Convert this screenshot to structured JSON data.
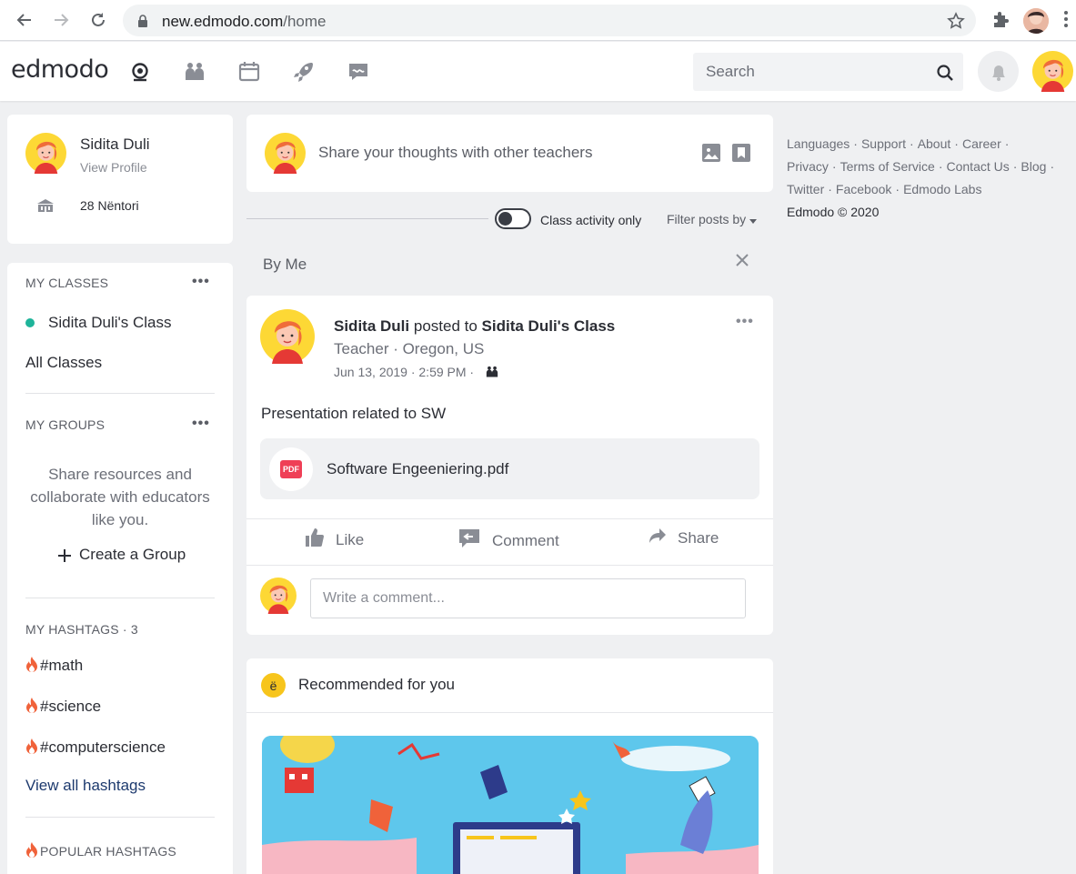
{
  "browser": {
    "url_domain": "new.edmodo.com",
    "url_path": "/home"
  },
  "header": {
    "logo": "edmodo",
    "search_placeholder": "Search"
  },
  "profile": {
    "name": "Sidita Duli",
    "view_profile": "View Profile",
    "school": "28 Nëntori"
  },
  "sidebar": {
    "my_classes_label": "MY CLASSES",
    "classes": [
      {
        "label": "Sidita Duli's Class",
        "color": "#1eb49a"
      }
    ],
    "all_classes": "All Classes",
    "my_groups_label": "MY GROUPS",
    "groups_description": "Share resources and collaborate with educators like you.",
    "create_group": "Create a Group",
    "my_hashtags_label": "MY HASHTAGS",
    "my_hashtags_count": "3",
    "hashtags": [
      "#math",
      "#science",
      "#computerscience"
    ],
    "view_all_hashtags": "View all hashtags",
    "popular_hashtags_label": "POPULAR HASHTAGS"
  },
  "composer": {
    "placeholder": "Share your thoughts with other teachers"
  },
  "filters": {
    "class_activity_only": "Class activity only",
    "filter_posts_by": "Filter posts by",
    "active_filter": "By Me"
  },
  "post": {
    "author": "Sidita Duli",
    "posted_to_text": "posted to",
    "target": "Sidita Duli's Class",
    "role": "Teacher · Oregon, US",
    "time": "Jun 13, 2019 · 2:59 PM ·",
    "body": "Presentation related to SW",
    "attachment_name": "Software Engeeniering.pdf",
    "attachment_type": "PDF",
    "actions": {
      "like": "Like",
      "comment": "Comment",
      "share": "Share"
    },
    "comment_placeholder": "Write a comment..."
  },
  "recommended": {
    "icon_letter": "ë",
    "title": "Recommended for you"
  },
  "footer": {
    "links": [
      "Languages",
      "Support",
      "About",
      "Career",
      "Privacy",
      "Terms of Service",
      "Contact Us",
      "Blog",
      "Twitter",
      "Facebook",
      "Edmodo Labs"
    ],
    "copyright": "Edmodo © 2020"
  },
  "colors": {
    "accent_teal": "#1eb49a",
    "pdf_red": "#ef3f56",
    "hashtag_fire": "#f0623a",
    "link_blue": "#1d3a6e"
  }
}
